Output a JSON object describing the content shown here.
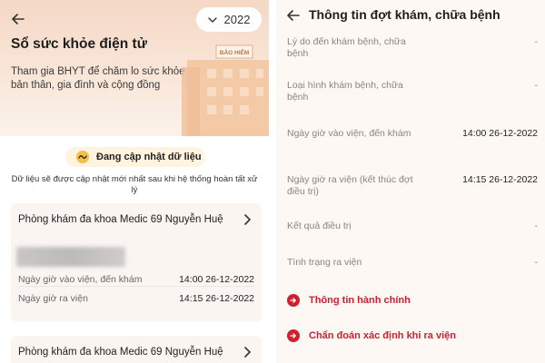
{
  "left_panel": {
    "year": "2022",
    "title": "Sổ sức khỏe điện tử",
    "subtitle": "Tham gia BHYT để chăm lo sức khỏe bản thân, gia đình và cộng đồng",
    "building_sign": "BẢO HIỂM",
    "update_status": "Đang cập nhật dữ liệu",
    "update_note": "Dữ liệu sẽ được cập nhật mới nhất sau khi hệ thống hoàn tất xử lý",
    "visits": [
      {
        "clinic": "Phòng khám đa khoa Medic 69 Nguyễn Huệ",
        "admit_label": "Ngày giờ vào viện, đến khám",
        "admit_value": "14:00 26-12-2022",
        "discharge_label": "Ngày giờ ra viện",
        "discharge_value": "14:15 26-12-2022"
      },
      {
        "clinic": "Phòng khám đa khoa Medic 69 Nguyễn Huệ"
      }
    ]
  },
  "right_panel": {
    "title": "Thông tin đợt khám, chữa bệnh",
    "rows": [
      {
        "label": "Lý do đến khám bệnh, chữa bệnh",
        "value": "-"
      },
      {
        "label": "Loại hình khám bệnh, chữa bệnh",
        "value": "-"
      },
      {
        "label": "Ngày giờ vào viện, đến khám",
        "value": "14:00 26-12-2022"
      },
      {
        "label": "Ngày giờ ra viện (kết thúc đợt điều trị)",
        "value": "14:15 26-12-2022"
      },
      {
        "label": "Kết quả điều trị",
        "value": "-"
      },
      {
        "label": "Tình trạng ra viện",
        "value": "-"
      }
    ],
    "actions": [
      {
        "label": "Thông tin hành chính"
      },
      {
        "label": "Chẩn đoán xác định khi ra viện"
      }
    ]
  },
  "colors": {
    "accent": "#cf2031",
    "hero_top": "#f5d8c6",
    "panel_bg": "#fdf8f4"
  },
  "icons": [
    "back-arrow-icon",
    "chevron-down-icon",
    "chevron-right-icon",
    "sync-icon",
    "arrow-right-circle-icon"
  ]
}
